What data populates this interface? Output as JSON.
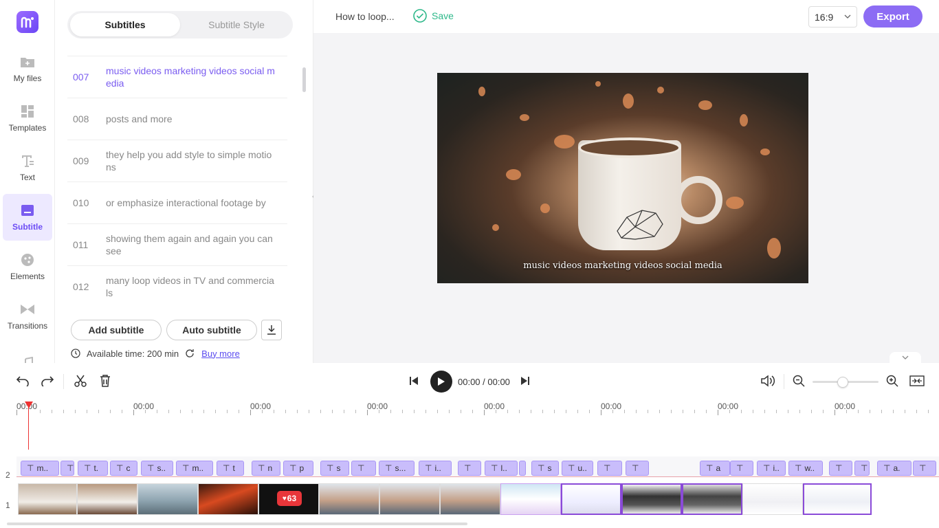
{
  "nav": {
    "items": [
      {
        "label": "My files",
        "icon": "folder-plus-icon"
      },
      {
        "label": "Templates",
        "icon": "templates-icon"
      },
      {
        "label": "Text",
        "icon": "text-icon"
      },
      {
        "label": "Subtitle",
        "icon": "subtitle-icon",
        "active": true
      },
      {
        "label": "Elements",
        "icon": "elements-icon"
      },
      {
        "label": "Transitions",
        "icon": "transitions-icon"
      },
      {
        "label": "",
        "icon": "music-icon"
      }
    ]
  },
  "panel": {
    "tabs": [
      "Subtitles",
      "Subtitle Style"
    ],
    "rows": [
      {
        "num": "007",
        "text": "music videos marketing videos social media",
        "active": true
      },
      {
        "num": "008",
        "text": "posts and more"
      },
      {
        "num": "009",
        "text": "they help you add style to simple motions"
      },
      {
        "num": "010",
        "text": "or emphasize interactional footage by"
      },
      {
        "num": "011",
        "text": "showing them again and again you can see"
      },
      {
        "num": "012",
        "text": "many loop videos in TV and commercials"
      }
    ],
    "add_label": "Add subtitle",
    "auto_label": "Auto subtitle",
    "available": "Available time: 200 min",
    "buy_more": "Buy more"
  },
  "topbar": {
    "project_name": "How to loop...",
    "save_label": "Save",
    "ratio": "16:9",
    "export_label": "Export"
  },
  "preview": {
    "caption": "music videos marketing videos social media"
  },
  "controls": {
    "timecode": "00:00 / 00:00"
  },
  "timeline": {
    "ruler_labels": [
      "00:00",
      "00:00",
      "00:00",
      "00:00",
      "00:00",
      "00:00",
      "00:00",
      "00:00"
    ],
    "track_labels": [
      "2",
      "1"
    ],
    "subtitle_clips": [
      "m..",
      "",
      "t.",
      "c",
      "s..",
      "m..",
      "t",
      "n",
      "p",
      "s",
      "",
      "s...",
      "i..",
      "",
      "l..",
      "",
      "s",
      "u..",
      "",
      "",
      "a",
      "",
      "i..",
      "w..",
      "",
      "",
      "a.",
      ""
    ],
    "like_count": "63"
  },
  "colors": {
    "accent": "#8c6cf4",
    "save": "#2eb88a",
    "playhead": "#ee3333"
  }
}
